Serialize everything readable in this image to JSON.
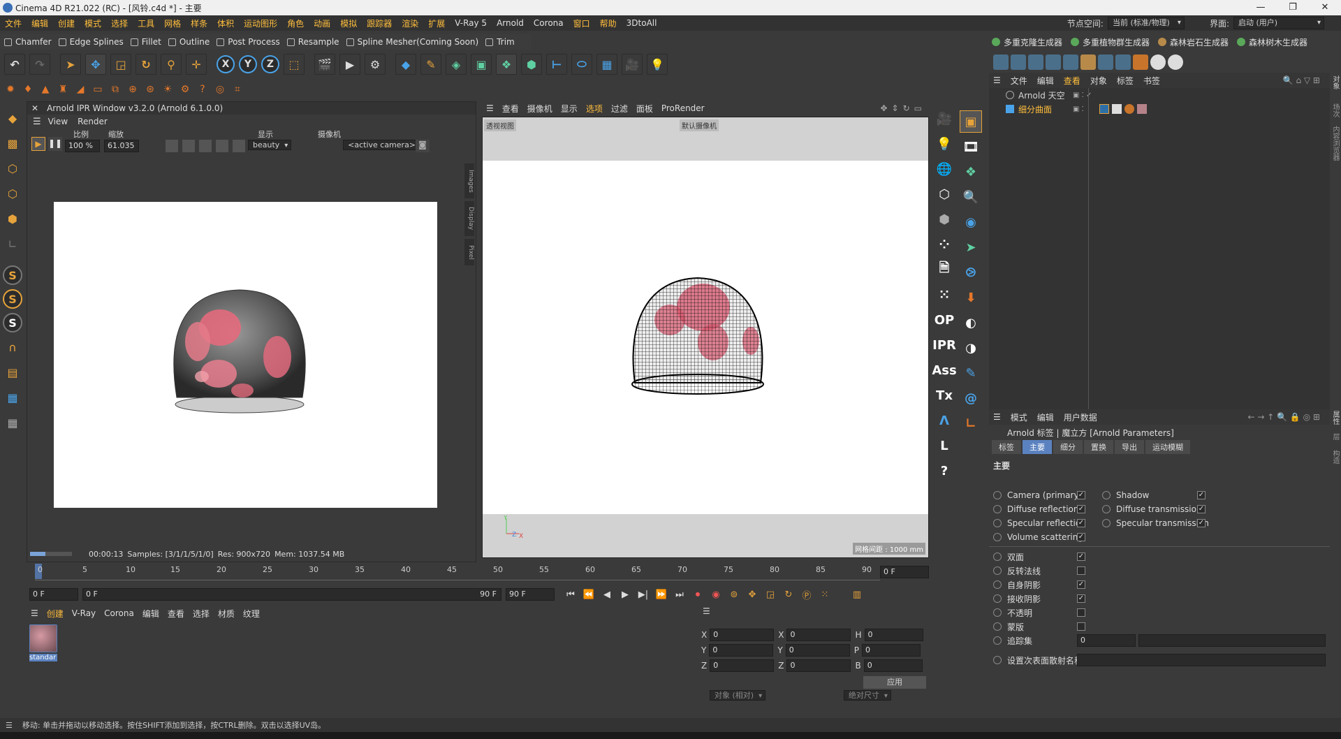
{
  "window": {
    "title": "Cinema 4D R21.022 (RC) - [风铃.c4d *] - 主要",
    "minimize": "—",
    "maximize": "❐",
    "close": "✕"
  },
  "menubar": {
    "items": [
      "文件",
      "编辑",
      "创建",
      "模式",
      "选择",
      "工具",
      "网格",
      "样条",
      "体积",
      "运动图形",
      "角色",
      "动画",
      "模拟",
      "跟踪器",
      "渲染",
      "扩展",
      "V-Ray 5",
      "Arnold",
      "Corona",
      "窗口",
      "帮助",
      "3DtoAll"
    ],
    "node_space_label": "节点空间:",
    "node_space_value": "当前 (标准/物理)",
    "interface_label": "界面:",
    "interface_value": "启动 (用户)"
  },
  "plugin_bar": [
    "Chamfer",
    "Edge Splines",
    "Fillet",
    "Outline",
    "Post Process",
    "Resample",
    "Spline Mesher(Coming Soon)",
    "Trim"
  ],
  "plugin_bar_right": [
    "多重克隆生成器",
    "多重植物群生成器",
    "森林岩石生成器",
    "森林树木生成器"
  ],
  "ipr": {
    "title": "Arnold IPR Window v3.2.0 (Arnold 6.1.0.0)",
    "menu": [
      "View",
      "Render"
    ],
    "scale_label": "比例",
    "scale_value": "100 %",
    "zoom_label": "缩放",
    "zoom_value": "61.035",
    "display_label": "显示",
    "display_value": "beauty",
    "camera_label": "摄像机",
    "camera_value": "<active camera>",
    "side_tabs": [
      "Images",
      "Display",
      "Pixel"
    ],
    "status_time": "00:00:13",
    "status_samples": "Samples: [3/1/1/5/1/0]",
    "status_res": "Res: 900x720",
    "status_mem": "Mem: 1037.54 MB"
  },
  "viewport": {
    "menu": [
      "查看",
      "摄像机",
      "显示",
      "选项",
      "过滤",
      "面板",
      "ProRender"
    ],
    "label_view": "透视视图",
    "label_camera": "默认摄像机",
    "grid_label": "网格间距 : 1000 mm"
  },
  "midtools": [
    "OP",
    "IPR",
    "Ass",
    "Tx",
    "L",
    "?"
  ],
  "object_manager": {
    "menu": [
      "文件",
      "编辑",
      "查看",
      "对象",
      "标签",
      "书签"
    ],
    "objects": [
      {
        "name": "Arnold 天空",
        "selected": false
      },
      {
        "name": "细分曲面",
        "selected": true
      }
    ]
  },
  "attributes": {
    "menu": [
      "模式",
      "编辑",
      "用户数据"
    ],
    "title": "Arnold 标签 | 魔立方 [Arnold Parameters]",
    "tabs": [
      "标签",
      "主要",
      "细分",
      "置换",
      "导出",
      "运动模糊"
    ],
    "active_tab": "主要",
    "section": "主要",
    "props_left": [
      "Camera (primary)",
      "Diffuse reflection",
      "Specular reflection",
      "Volume scattering"
    ],
    "props_right": [
      "Shadow",
      "Diffuse transmission",
      "Specular transmission"
    ],
    "props_cn": [
      "双面",
      "反转法线",
      "自身阴影",
      "接收阴影",
      "不透明",
      "蒙版",
      "追踪集"
    ],
    "trace_value": "0",
    "scatter_label": "设置次表面散射名称"
  },
  "timeline": {
    "ticks": [
      "0",
      "5",
      "10",
      "15",
      "20",
      "25",
      "30",
      "35",
      "40",
      "45",
      "50",
      "55",
      "60",
      "65",
      "70",
      "75",
      "80",
      "85",
      "90"
    ],
    "end_field": "0 F",
    "start": "0 F",
    "current": "0 F",
    "end": "90 F",
    "max": "90 F"
  },
  "material_manager": {
    "menu": [
      "创建",
      "V-Ray",
      "Corona",
      "编辑",
      "查看",
      "选择",
      "材质",
      "纹理"
    ],
    "materials": [
      "standar"
    ]
  },
  "coordinates": {
    "rows": [
      {
        "a": "X",
        "av": "0",
        "b": "X",
        "bv": "0",
        "c": "H",
        "cv": "0"
      },
      {
        "a": "Y",
        "av": "0",
        "b": "Y",
        "bv": "0",
        "c": "P",
        "cv": "0"
      },
      {
        "a": "Z",
        "av": "0",
        "b": "Z",
        "bv": "0",
        "c": "B",
        "cv": "0"
      }
    ],
    "mode1": "对象 (相对)",
    "mode2": "绝对尺寸",
    "apply": "应用"
  },
  "statusbar": {
    "text": "移动: 单击并拖动以移动选择。按住SHIFT添加到选择，按CTRL删除。双击以选择UV岛。"
  },
  "right_vertical_tabs": [
    "对象",
    "场次",
    "内容浏览器",
    "属性",
    "层",
    "构造"
  ]
}
